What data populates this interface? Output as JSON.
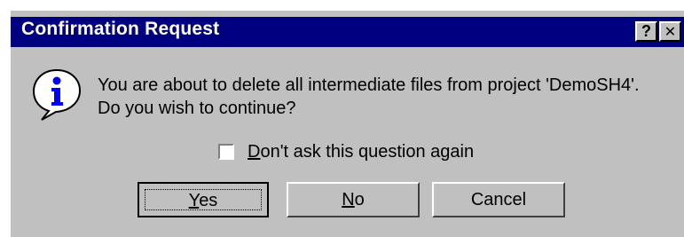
{
  "dialog": {
    "title": "Confirmation Request",
    "help_glyph": "?",
    "close_glyph": "✕",
    "icon": "info-icon",
    "message_line1": "You are about to delete all intermediate files from project 'DemoSH4'.",
    "message_line2": "Do you wish to continue?",
    "checkbox": {
      "checked": false,
      "label_mnemonic": "D",
      "label_rest": "on't ask this question again"
    },
    "buttons": {
      "yes_mnemonic": "Y",
      "yes_rest": "es",
      "no_mnemonic": "N",
      "no_rest": "o",
      "cancel": "Cancel"
    }
  },
  "colors": {
    "titlebar": "#000080",
    "face": "#c0c0c0",
    "icon_fill": "#0000ff"
  }
}
